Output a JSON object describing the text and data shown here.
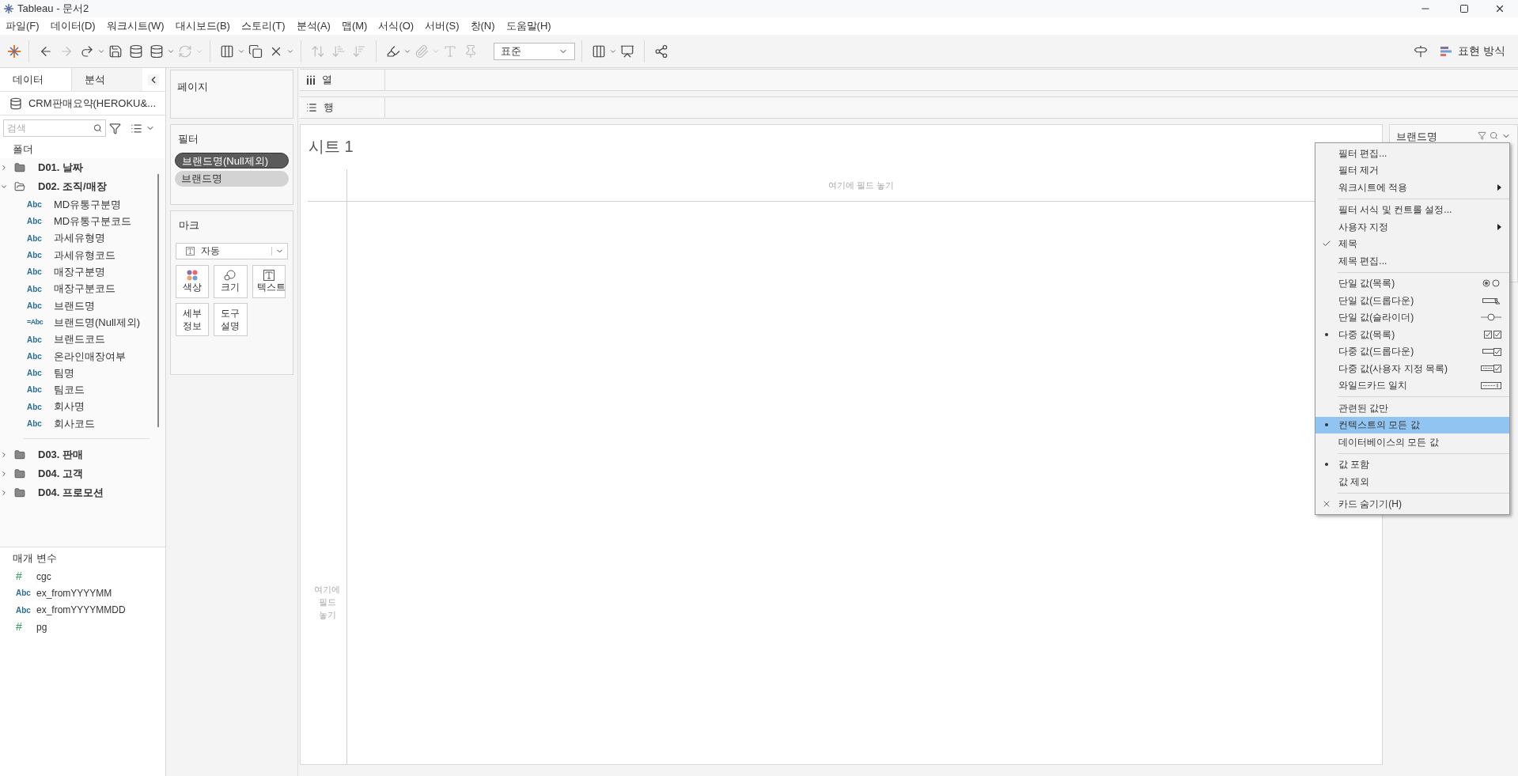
{
  "window": {
    "title": "Tableau - 문서2"
  },
  "menu_bar": [
    "파일(F)",
    "데이터(D)",
    "워크시트(W)",
    "대시보드(B)",
    "스토리(T)",
    "분석(A)",
    "맵(M)",
    "서식(O)",
    "서버(S)",
    "창(N)",
    "도움말(H)"
  ],
  "toolbar": {
    "view_size": "표준",
    "show_me": "표현 방식"
  },
  "data_pane": {
    "tabs": [
      {
        "label": "데이터",
        "selected": true
      },
      {
        "label": "분석",
        "selected": false
      }
    ],
    "data_source": "CRM판매요약(HEROKU&...",
    "search": {
      "placeholder": "검색"
    },
    "folders_heading": "폴더",
    "folders": [
      {
        "name": "D01. 날짜",
        "expanded": false
      },
      {
        "name": "D02. 조직/매장",
        "expanded": true,
        "children": [
          {
            "type_label": "Abc",
            "kind": "dimension",
            "name": "MD유통구분명"
          },
          {
            "type_label": "Abc",
            "kind": "dimension",
            "name": "MD유통구분코드"
          },
          {
            "type_label": "Abc",
            "kind": "dimension",
            "name": "과세유형명"
          },
          {
            "type_label": "Abc",
            "kind": "dimension",
            "name": "과세유형코드"
          },
          {
            "type_label": "Abc",
            "kind": "dimension",
            "name": "매장구분명"
          },
          {
            "type_label": "Abc",
            "kind": "dimension",
            "name": "매장구분코드"
          },
          {
            "type_label": "Abc",
            "kind": "dimension",
            "name": "브랜드명"
          },
          {
            "type_label": "=Abc",
            "kind": "calc",
            "name": "브랜드명(Null제외)"
          },
          {
            "type_label": "Abc",
            "kind": "dimension",
            "name": "브랜드코드"
          },
          {
            "type_label": "Abc",
            "kind": "dimension",
            "name": "온라인매장여부"
          },
          {
            "type_label": "Abc",
            "kind": "dimension",
            "name": "팀명"
          },
          {
            "type_label": "Abc",
            "kind": "dimension",
            "name": "팀코드"
          },
          {
            "type_label": "Abc",
            "kind": "dimension",
            "name": "회사명"
          },
          {
            "type_label": "Abc",
            "kind": "dimension",
            "name": "회사코드"
          }
        ]
      },
      {
        "name": "D03. 판매",
        "expanded": false
      },
      {
        "name": "D04. 고객",
        "expanded": false
      },
      {
        "name": "D04. 프로모션",
        "expanded": false
      }
    ]
  },
  "parameters": {
    "heading": "매개 변수",
    "items": [
      {
        "type_label": "#",
        "kind": "number",
        "name": "cgc"
      },
      {
        "type_label": "Abc",
        "kind": "dimension",
        "name": "ex_fromYYYYMM"
      },
      {
        "type_label": "Abc",
        "kind": "dimension",
        "name": "ex_fromYYYYMMDD"
      },
      {
        "type_label": "#",
        "kind": "number",
        "name": "pg"
      }
    ]
  },
  "pages_shelf": {
    "title": "페이지"
  },
  "filters_shelf": {
    "title": "필터",
    "pills": [
      {
        "label": "브랜드명(Null제외)",
        "context": true
      },
      {
        "label": "브랜드명",
        "context": false
      }
    ]
  },
  "marks_card": {
    "title": "마크",
    "mark_type": "자동",
    "buttons": [
      {
        "label": "색상",
        "kind": "color"
      },
      {
        "label": "크기",
        "kind": "size"
      },
      {
        "label": "텍스트",
        "kind": "text"
      },
      {
        "label": "세부 정보",
        "kind": "detail"
      },
      {
        "label": "도구 설명",
        "kind": "tooltip"
      }
    ]
  },
  "columns_shelf": {
    "label": "열"
  },
  "rows_shelf": {
    "label": "행"
  },
  "view": {
    "title": "시트 1",
    "column_drop_hint": "여기에 필드 놓기",
    "row_drop_hint": "여기에 필드 놓기"
  },
  "filter_card": {
    "title": "브랜드명"
  },
  "context_menu": {
    "items": [
      {
        "kind": "item",
        "label": "필터 편집...",
        "submenu": false,
        "selected": false,
        "checked": false,
        "chosen": false
      },
      {
        "kind": "item",
        "label": "필터 제거",
        "submenu": false,
        "selected": false,
        "checked": false,
        "chosen": false
      },
      {
        "kind": "item",
        "label": "워크시트에 적용",
        "submenu": true,
        "selected": false,
        "checked": false,
        "chosen": false
      },
      {
        "kind": "separator"
      },
      {
        "kind": "item",
        "label": "필터 서식 및 컨트롤 설정...",
        "submenu": false,
        "selected": false,
        "checked": false,
        "chosen": false
      },
      {
        "kind": "item",
        "label": "사용자 지정",
        "submenu": true,
        "selected": false,
        "checked": false,
        "chosen": false
      },
      {
        "kind": "item",
        "label": "제목",
        "submenu": false,
        "selected": false,
        "checked": true,
        "chosen": false
      },
      {
        "kind": "item",
        "label": "제목 편집...",
        "submenu": false,
        "selected": false,
        "checked": false,
        "chosen": false
      },
      {
        "kind": "separator"
      },
      {
        "kind": "radio-list",
        "label": "단일 값(목록)",
        "submenu": false,
        "selected": false,
        "checked": false,
        "chosen": false
      },
      {
        "kind": "dropdown",
        "label": "단일 값(드롭다운)",
        "submenu": false,
        "selected": false,
        "checked": false,
        "chosen": false
      },
      {
        "kind": "slider",
        "label": "단일 값(슬라이더)",
        "submenu": false,
        "selected": false,
        "checked": false,
        "chosen": false
      },
      {
        "kind": "checklist",
        "label": "다중 값(목록)",
        "submenu": false,
        "selected": false,
        "checked": false,
        "chosen": true
      },
      {
        "kind": "check-dropdown",
        "label": "다중 값(드롭다운)",
        "submenu": false,
        "selected": false,
        "checked": false,
        "chosen": false
      },
      {
        "kind": "custom-list",
        "label": "다중 값(사용자 지정 목록)",
        "submenu": false,
        "selected": false,
        "checked": false,
        "chosen": false
      },
      {
        "kind": "wildcard",
        "label": "와일드카드 일치",
        "submenu": false,
        "selected": false,
        "checked": false,
        "chosen": false
      },
      {
        "kind": "separator"
      },
      {
        "kind": "item",
        "label": "관련된 값만",
        "submenu": false,
        "selected": false,
        "checked": false,
        "chosen": false
      },
      {
        "kind": "item",
        "label": "컨텍스트의 모든 값",
        "submenu": false,
        "selected": true,
        "checked": false,
        "chosen": true
      },
      {
        "kind": "item",
        "label": "데이터베이스의 모든 값",
        "submenu": false,
        "selected": false,
        "checked": false,
        "chosen": false
      },
      {
        "kind": "separator"
      },
      {
        "kind": "item",
        "label": "값 포함",
        "submenu": false,
        "selected": false,
        "checked": false,
        "chosen": true
      },
      {
        "kind": "item",
        "label": "값 제외",
        "submenu": false,
        "selected": false,
        "checked": false,
        "chosen": false
      },
      {
        "kind": "separator"
      },
      {
        "kind": "hide-item",
        "label": "카드 숨기기(H)",
        "submenu": false,
        "selected": false,
        "checked": false,
        "chosen": false
      }
    ]
  }
}
